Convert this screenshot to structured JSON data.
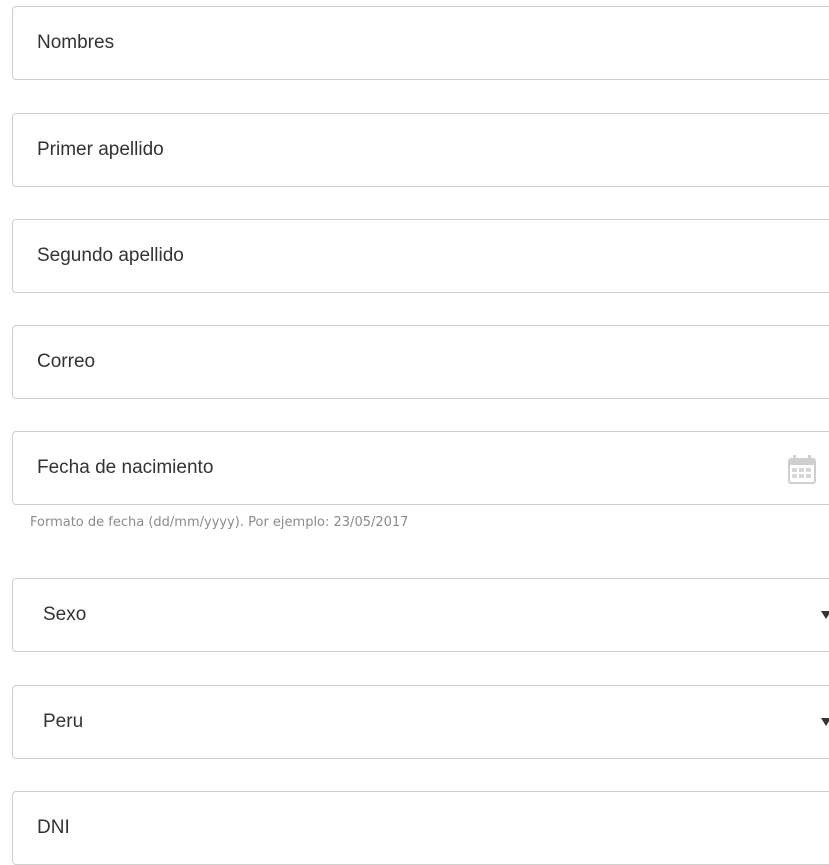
{
  "form": {
    "fields": [
      {
        "placeholder": "Nombres"
      },
      {
        "placeholder": "Primer apellido"
      },
      {
        "placeholder": "Segundo apellido"
      },
      {
        "placeholder": "Correo"
      },
      {
        "placeholder": "Fecha de nacimiento",
        "icon": "calendar-icon"
      },
      {
        "value": "Sexo",
        "type": "select"
      },
      {
        "value": "Peru",
        "type": "select"
      },
      {
        "placeholder": "DNI"
      }
    ],
    "birthdate_help": "Formato de fecha (dd/mm/yyyy). Por ejemplo: 23/05/2017"
  },
  "icons": {
    "calendar": "calendar-icon",
    "select_caret": "chevron-down-icon"
  },
  "colors": {
    "border": "#cfcfcf",
    "text": "#333333",
    "help_text": "#8b8b8b",
    "icon": "#cfcfcf"
  }
}
